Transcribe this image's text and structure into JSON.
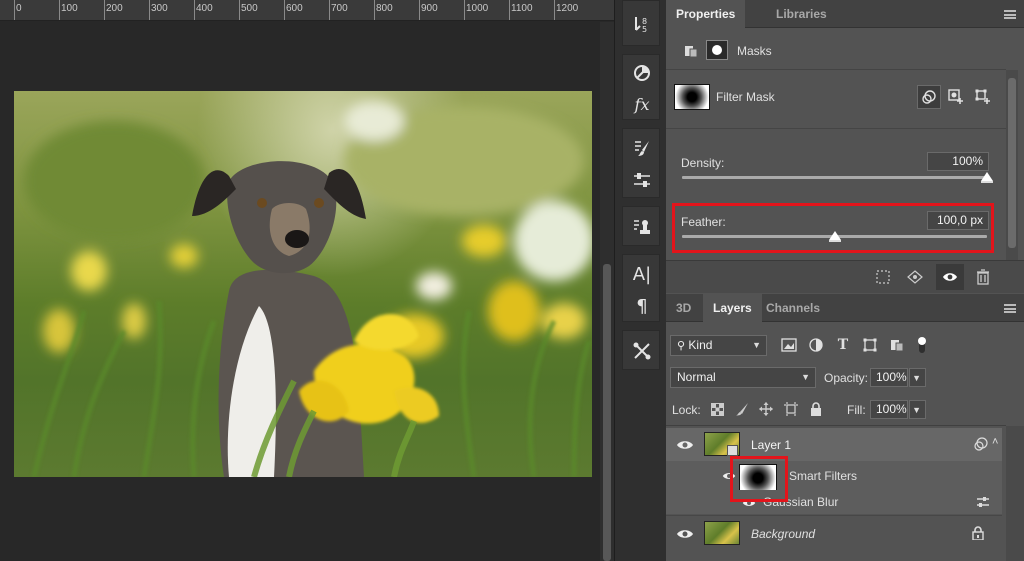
{
  "ruler": {
    "ticks": [
      "0",
      "100",
      "200",
      "300",
      "400",
      "500",
      "600",
      "700",
      "800",
      "900",
      "1000",
      "1100",
      "1200"
    ]
  },
  "tools": {
    "items": [
      "history-brush-icon",
      "mask-icon",
      "fx-icon",
      "brush-settings-icon",
      "adjustment-icon",
      "clone-stamp-icon",
      "character-icon",
      "paragraph-icon",
      "tools-icon"
    ]
  },
  "properties": {
    "tabs": [
      "Properties",
      "Libraries"
    ],
    "header_label": "Masks",
    "mask_name": "Filter Mask",
    "density_label": "Density:",
    "density_value": "100%",
    "density_fraction": 1.0,
    "feather_label": "Feather:",
    "feather_value": "100,0 px",
    "feather_fraction": 0.5
  },
  "layers": {
    "tabs": [
      "3D",
      "Layers",
      "Channels"
    ],
    "filter_kind": "Kind",
    "blend_mode": "Normal",
    "opacity_label": "Opacity:",
    "opacity_value": "100%",
    "lock_label": "Lock:",
    "fill_label": "Fill:",
    "fill_value": "100%",
    "rows": [
      {
        "name": "Layer 1"
      },
      {
        "name": "Smart Filters"
      },
      {
        "name": "Gaussian Blur"
      },
      {
        "name": "Background"
      }
    ]
  },
  "colors": {
    "highlight": "#e3141b",
    "panel_bg": "#535353",
    "tab_bar": "#424242"
  }
}
